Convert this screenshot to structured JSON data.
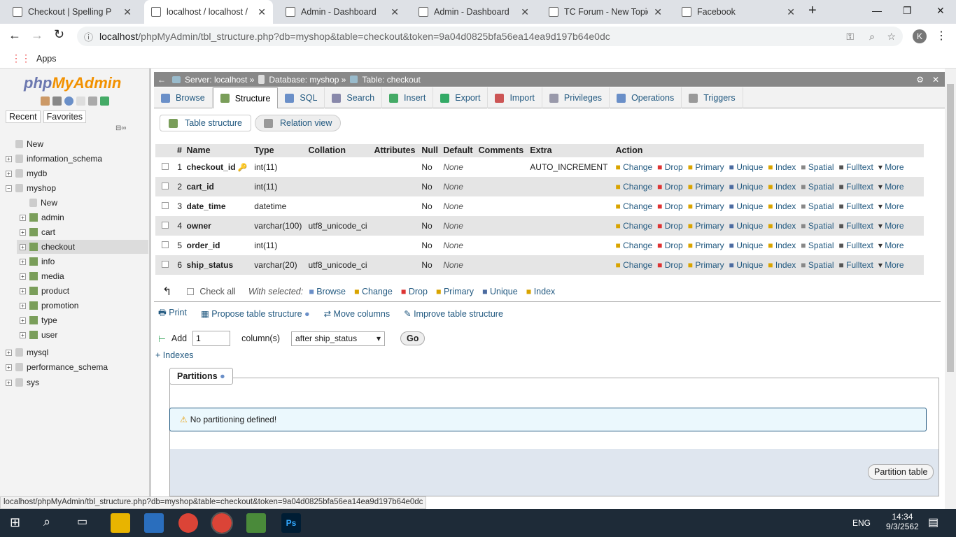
{
  "browser": {
    "tabs": [
      {
        "title": "Checkout | Spelling PLC"
      },
      {
        "title": "localhost / localhost / m",
        "active": true
      },
      {
        "title": "Admin - Dashboard"
      },
      {
        "title": "Admin - Dashboard"
      },
      {
        "title": "TC Forum - New Topic"
      },
      {
        "title": "Facebook"
      }
    ],
    "url_host": "localhost",
    "url_path": "/phpMyAdmin/tbl_structure.php?db=myshop&table=checkout&token=9a04d0825bfa56ea14ea9d197b64e0dc",
    "bookmark_apps": "Apps",
    "profile_initial": "K"
  },
  "sidebar": {
    "logo": "phpMyAdmin",
    "recent": "Recent",
    "favorites": "Favorites",
    "tree": [
      {
        "label": "New",
        "level": 0
      },
      {
        "label": "information_schema",
        "level": 0
      },
      {
        "label": "mydb",
        "level": 0
      },
      {
        "label": "myshop",
        "level": 0
      },
      {
        "label": "New",
        "level": 1
      },
      {
        "label": "admin",
        "level": 1
      },
      {
        "label": "cart",
        "level": 1
      },
      {
        "label": "checkout",
        "level": 1,
        "selected": true
      },
      {
        "label": "info",
        "level": 1
      },
      {
        "label": "media",
        "level": 1
      },
      {
        "label": "product",
        "level": 1
      },
      {
        "label": "promotion",
        "level": 1
      },
      {
        "label": "type",
        "level": 1
      },
      {
        "label": "user",
        "level": 1
      },
      {
        "label": "mysql",
        "level": 0
      },
      {
        "label": "performance_schema",
        "level": 0
      },
      {
        "label": "sys",
        "level": 0
      }
    ]
  },
  "breadcrumb": {
    "server": "Server: localhost »",
    "database": "Database: myshop »",
    "table": "Table: checkout"
  },
  "menu": [
    {
      "label": "Browse",
      "color": "#6a8fc8"
    },
    {
      "label": "Structure",
      "color": "#7a9e5a",
      "active": true
    },
    {
      "label": "SQL",
      "color": "#6a8fc8"
    },
    {
      "label": "Search",
      "color": "#88a"
    },
    {
      "label": "Insert",
      "color": "#4a6"
    },
    {
      "label": "Export",
      "color": "#3a6"
    },
    {
      "label": "Import",
      "color": "#c55"
    },
    {
      "label": "Privileges",
      "color": "#99a"
    },
    {
      "label": "Operations",
      "color": "#6a8fc8"
    },
    {
      "label": "Triggers",
      "color": "#999"
    }
  ],
  "subtabs": {
    "table_structure": "Table structure",
    "relation_view": "Relation view"
  },
  "columns_header": [
    "#",
    "Name",
    "Type",
    "Collation",
    "Attributes",
    "Null",
    "Default",
    "Comments",
    "Extra",
    "Action"
  ],
  "rows": [
    {
      "n": "1",
      "name": "checkout_id",
      "key": true,
      "type": "int(11)",
      "collation": "",
      "attributes": "",
      "null": "No",
      "default": "None",
      "comments": "",
      "extra": "AUTO_INCREMENT"
    },
    {
      "n": "2",
      "name": "cart_id",
      "type": "int(11)",
      "collation": "",
      "attributes": "",
      "null": "No",
      "default": "None",
      "comments": "",
      "extra": ""
    },
    {
      "n": "3",
      "name": "date_time",
      "type": "datetime",
      "collation": "",
      "attributes": "",
      "null": "No",
      "default": "None",
      "comments": "",
      "extra": ""
    },
    {
      "n": "4",
      "name": "owner",
      "type": "varchar(100)",
      "collation": "utf8_unicode_ci",
      "attributes": "",
      "null": "No",
      "default": "None",
      "comments": "",
      "extra": ""
    },
    {
      "n": "5",
      "name": "order_id",
      "type": "int(11)",
      "collation": "",
      "attributes": "",
      "null": "No",
      "default": "None",
      "comments": "",
      "extra": ""
    },
    {
      "n": "6",
      "name": "ship_status",
      "type": "varchar(20)",
      "collation": "utf8_unicode_ci",
      "attributes": "",
      "null": "No",
      "default": "None",
      "comments": "",
      "extra": ""
    }
  ],
  "row_actions": [
    "Change",
    "Drop",
    "Primary",
    "Unique",
    "Index",
    "Spatial",
    "Fulltext",
    "More"
  ],
  "bulk": {
    "check_all": "Check all",
    "with_selected": "With selected:",
    "actions": [
      "Browse",
      "Change",
      "Drop",
      "Primary",
      "Unique",
      "Index"
    ]
  },
  "links": {
    "print": "Print",
    "propose": "Propose table structure",
    "move": "Move columns",
    "improve": "Improve table structure"
  },
  "add": {
    "label": "Add",
    "value": "1",
    "columns": "column(s)",
    "position": "after ship_status",
    "go": "Go",
    "indexes": "+ Indexes"
  },
  "partitions": {
    "legend": "Partitions",
    "notice": "No partitioning defined!",
    "button": "Partition table"
  },
  "status_url": "localhost/phpMyAdmin/tbl_structure.php?db=myshop&table=checkout&token=9a04d0825bfa56ea14ea9d197b64e0dc",
  "taskbar": {
    "lang": "ENG",
    "time": "14:34",
    "date": "9/3/2562"
  }
}
